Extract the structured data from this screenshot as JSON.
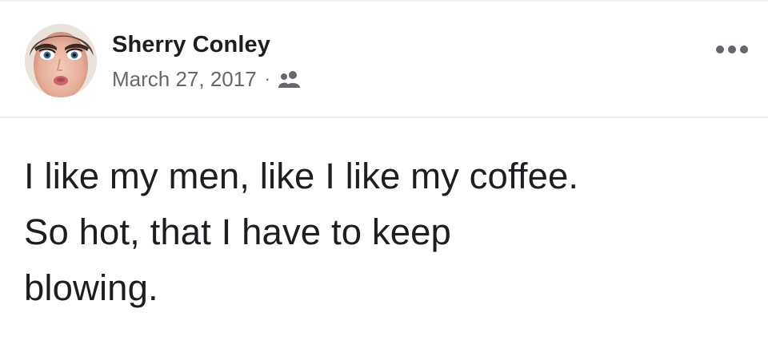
{
  "post": {
    "author_name": "Sherry Conley",
    "date": "March 27, 2017",
    "separator": "·",
    "audience_icon": "friends-icon",
    "more_icon": "more-options-icon",
    "text": "I like my men, like I like my coffee.\nSo hot, that I have to keep\nblowing."
  },
  "colors": {
    "name_text": "#1c1e21",
    "meta_text": "#65676b",
    "divider": "#eceef0",
    "background": "#ffffff"
  }
}
